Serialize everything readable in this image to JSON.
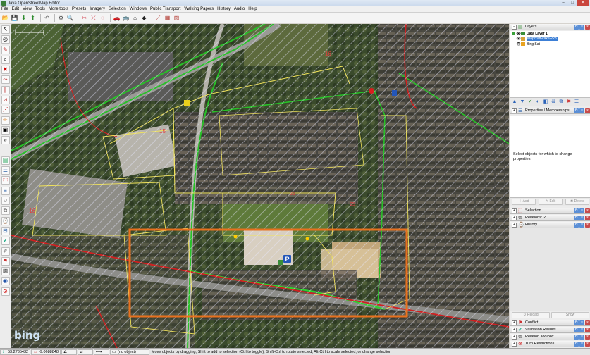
{
  "window": {
    "title": "Java OpenStreetMap Editor"
  },
  "menu": [
    "File",
    "Edit",
    "View",
    "Tools",
    "More tools",
    "Presets",
    "Imagery",
    "Selection",
    "Windows",
    "Public Transport",
    "Walking Papers",
    "History",
    "Audio",
    "Help"
  ],
  "map": {
    "labels": {
      "block_a": "16",
      "block_b": "15",
      "block_c": "16",
      "block_d": "26",
      "block_e": "25",
      "parking": "P"
    },
    "imagery_logo": "bing",
    "highlight_color": "#e8711e"
  },
  "layers": {
    "title": "Layers",
    "items": [
      {
        "name": "Data Layer 1"
      },
      {
        "name": "Mapcraft-cake-223"
      },
      {
        "name": "Bing Sat"
      }
    ]
  },
  "properties": {
    "title": "Properties / Memberships",
    "empty_text": "Select objects for which to change properties.",
    "buttons": {
      "add": "Add",
      "edit": "Edit",
      "delete": "Delete"
    }
  },
  "panels": {
    "selection": "Selection",
    "relations": "Relations: 2",
    "history": "History",
    "conflict": "Conflict",
    "validation": "Validation Results",
    "relation_toolbox": "Relation Toolbox",
    "turn_restrictions": "Turn Restrictions"
  },
  "validation_buttons": {
    "reload": "Reload",
    "show": "Show"
  },
  "status": {
    "lat": "53.2735432",
    "lon": "-9.0688848",
    "selection": "(no object)",
    "help": "Move objects by dragging; Shift to add to selection (Ctrl to toggle); Shift-Ctrl to rotate selected; Alt-Ctrl to scale selected; or change selection"
  }
}
